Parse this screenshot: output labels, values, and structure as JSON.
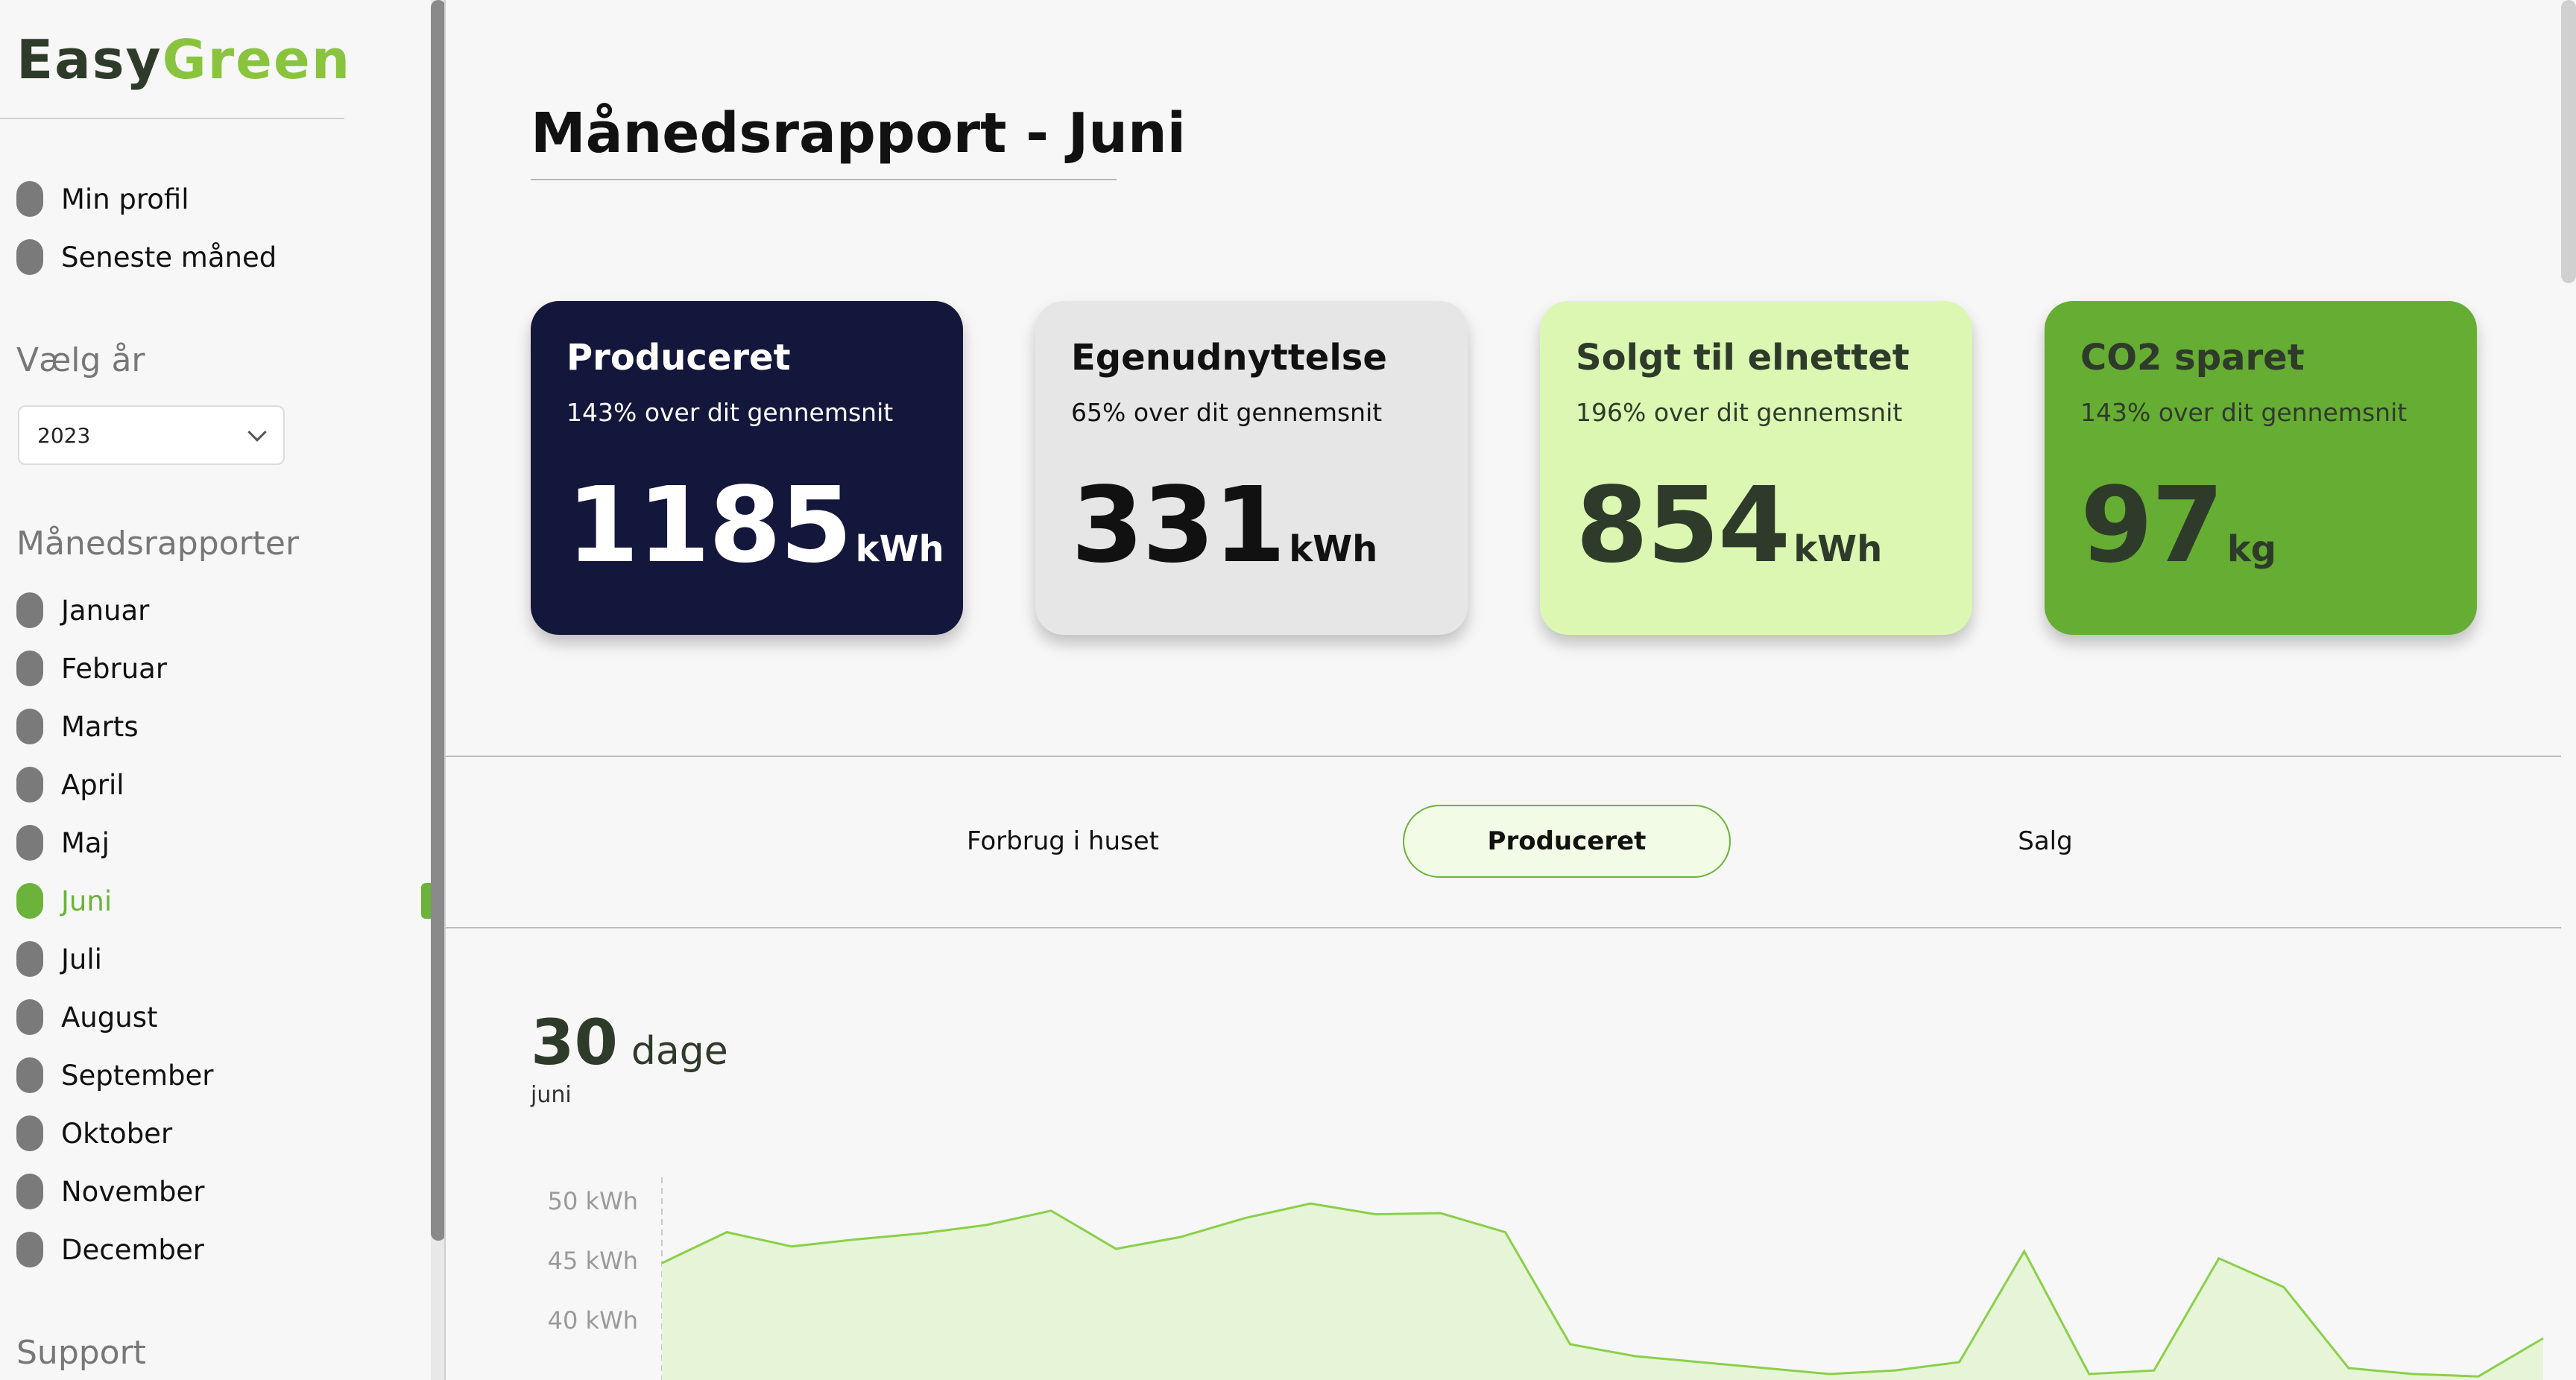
{
  "brand": {
    "part1": "Easy",
    "part2": "Green"
  },
  "sidebar": {
    "top_items": [
      {
        "label": "Min profil"
      },
      {
        "label": "Seneste måned"
      }
    ],
    "year_section_title": "Vælg år",
    "year_select_value": "2023",
    "reports_section_title": "Månedsrapporter",
    "months": [
      {
        "label": "Januar"
      },
      {
        "label": "Februar"
      },
      {
        "label": "Marts"
      },
      {
        "label": "April"
      },
      {
        "label": "Maj"
      },
      {
        "label": "Juni"
      },
      {
        "label": "Juli"
      },
      {
        "label": "August"
      },
      {
        "label": "September"
      },
      {
        "label": "Oktober"
      },
      {
        "label": "November"
      },
      {
        "label": "December"
      }
    ],
    "active_month": "Juni",
    "support_title": "Support"
  },
  "page": {
    "title": "Månedsrapport - Juni"
  },
  "cards": [
    {
      "title": "Produceret",
      "subtitle": "143% over dit gennemsnit",
      "value": "1185",
      "unit": "kWh",
      "bg": "#14173c",
      "fg": "#ffffff"
    },
    {
      "title": "Egenudnyttelse",
      "subtitle": "65% over dit gennemsnit",
      "value": "331",
      "unit": "kWh",
      "bg": "#e6e6e6",
      "fg": "#111111"
    },
    {
      "title": "Solgt til elnettet",
      "subtitle": "196% over dit gennemsnit",
      "value": "854",
      "unit": "kWh",
      "bg": "#dbf7b2",
      "fg": "#2f3b2a"
    },
    {
      "title": "CO2 sparet",
      "subtitle": "143% over dit gennemsnit",
      "value": "97",
      "unit": "kg",
      "bg": "#66ad33",
      "fg": "#2f3b2a"
    }
  ],
  "tabs": [
    {
      "label": "Forbrug i huset"
    },
    {
      "label": "Produceret"
    },
    {
      "label": "Salg"
    }
  ],
  "active_tab": "Produceret",
  "summary": {
    "count": "30",
    "unit": "dage",
    "month": "juni"
  },
  "chart_data": {
    "type": "area",
    "ylabel_ticks": [
      "50 kWh",
      "45 kWh",
      "40 kWh"
    ],
    "y_tick_values": [
      50,
      45,
      40
    ],
    "ylim": [
      35,
      52
    ],
    "x": [
      1,
      2,
      3,
      4,
      5,
      6,
      7,
      8,
      9,
      10,
      11,
      12,
      13,
      14,
      15,
      16,
      17,
      18,
      19,
      20,
      21,
      22,
      23,
      24,
      25,
      26,
      27,
      28,
      29,
      30
    ],
    "values": [
      44.8,
      47.4,
      46.2,
      46.8,
      47.3,
      48.0,
      49.2,
      46.0,
      47.0,
      48.6,
      49.8,
      48.9,
      49.0,
      47.4,
      38.0,
      37.0,
      36.5,
      36.0,
      35.5,
      35.8,
      36.5,
      45.8,
      35.5,
      35.8,
      45.2,
      42.8,
      36.0,
      35.5,
      35.3,
      38.5
    ],
    "fill_color": "#e6f5d8",
    "line_color": "#8ad04a",
    "grid": false
  }
}
